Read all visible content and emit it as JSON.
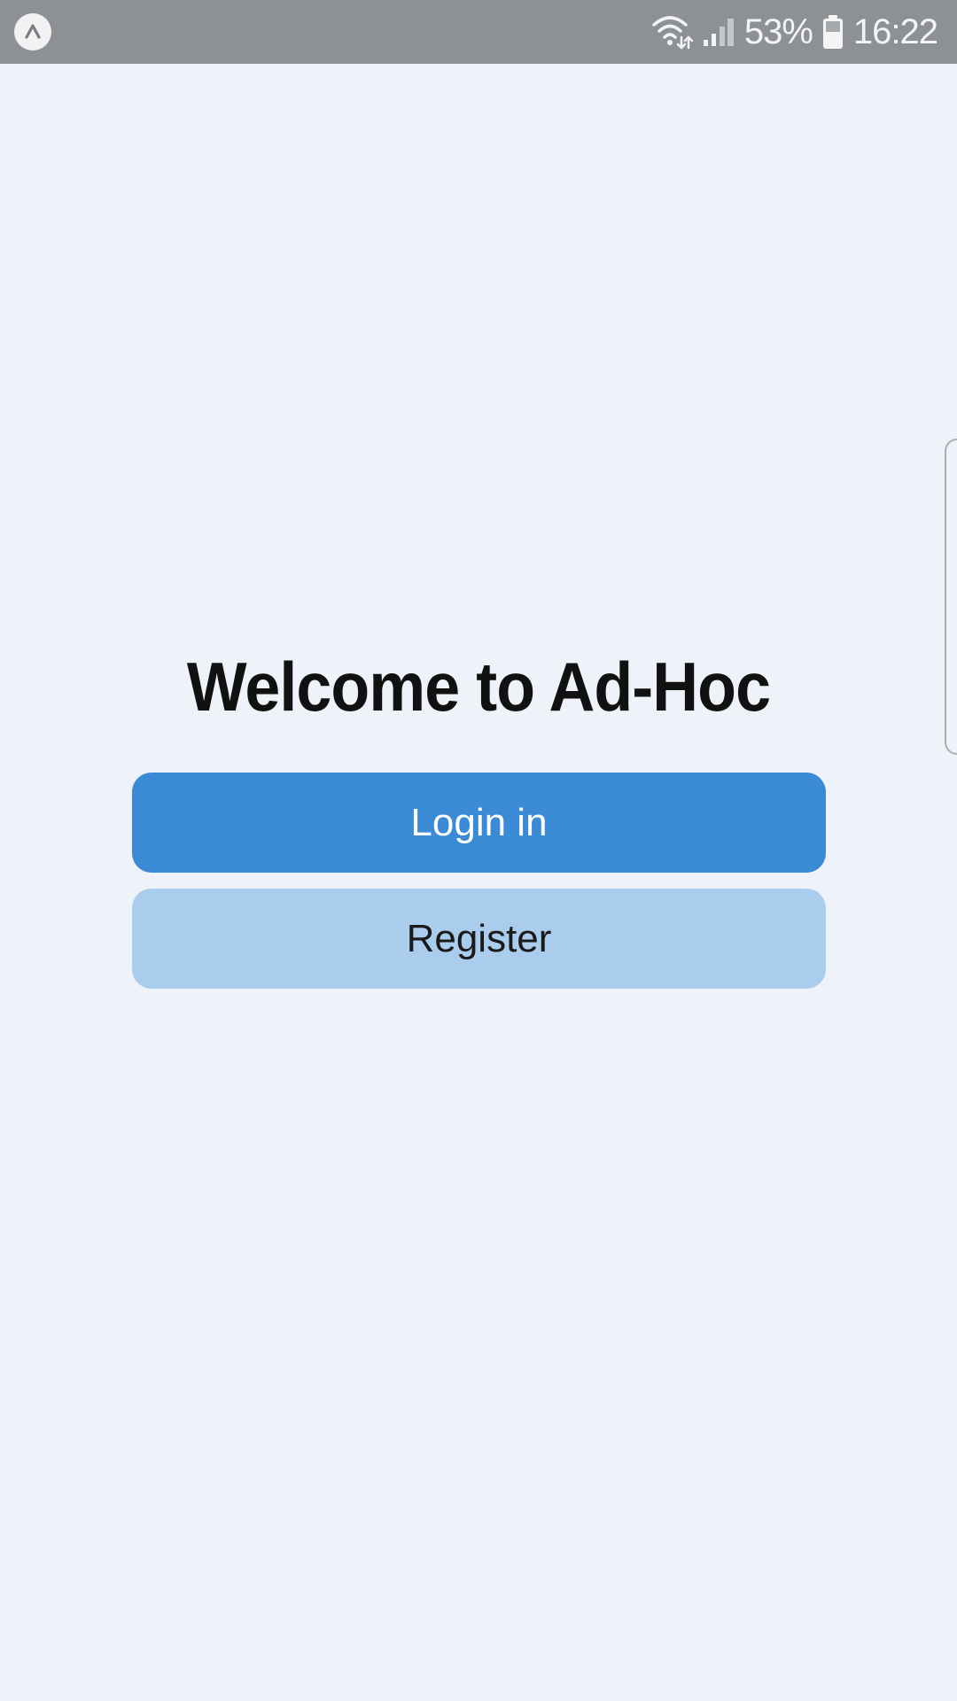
{
  "status_bar": {
    "battery_percent": "53%",
    "time": "16:22",
    "icons": [
      "app-notification-icon",
      "wifi-icon",
      "signal-icon",
      "battery-icon"
    ]
  },
  "main": {
    "title": "Welcome to Ad-Hoc",
    "login_label": "Login in",
    "register_label": "Register"
  },
  "colors": {
    "background": "#eef3fa",
    "status_bar": "#8d9196",
    "login_button": "#3a8ad6",
    "register_button": "#aacdee"
  }
}
